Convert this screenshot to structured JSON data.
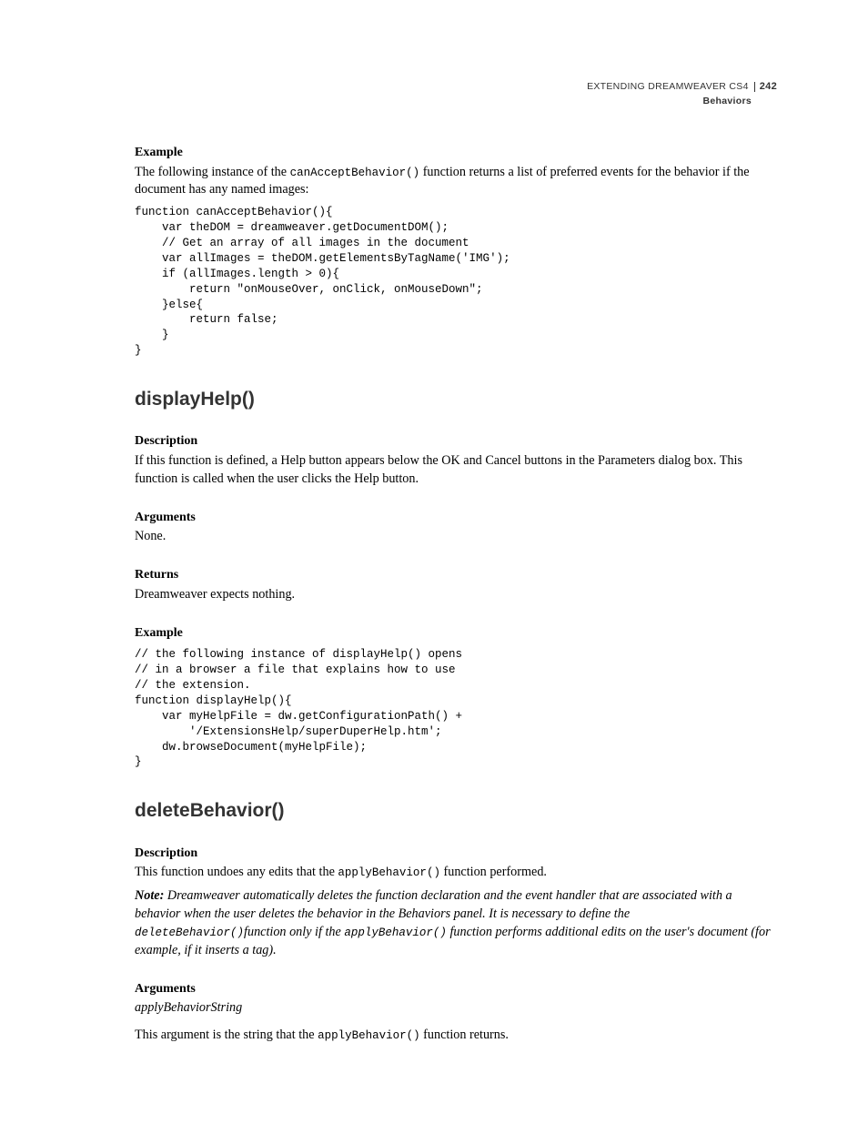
{
  "header": {
    "title": "EXTENDING DREAMWEAVER CS4",
    "section": "Behaviors",
    "page_number": "242"
  },
  "s1": {
    "example_h": "Example",
    "example_p_a": "The following instance of the ",
    "example_fn": "canAcceptBehavior()",
    "example_p_b": " function returns a list of preferred events for the behavior if the document has any named images:",
    "code": "function canAcceptBehavior(){\n    var theDOM = dreamweaver.getDocumentDOM();\n    // Get an array of all images in the document\n    var allImages = theDOM.getElementsByTagName('IMG');\n    if (allImages.length > 0){\n        return \"onMouseOver, onClick, onMouseDown\";\n    }else{\n        return false;\n    }\n}"
  },
  "s2": {
    "title": "displayHelp()",
    "desc_h": "Description",
    "desc_p": "If this function is defined, a Help button appears below the OK and Cancel buttons in the Parameters dialog box. This function is called when the user clicks the Help button.",
    "args_h": "Arguments",
    "args_p": "None.",
    "ret_h": "Returns",
    "ret_p": "Dreamweaver expects nothing.",
    "ex_h": "Example",
    "code": "// the following instance of displayHelp() opens\n// in a browser a file that explains how to use\n// the extension.\nfunction displayHelp(){\n    var myHelpFile = dw.getConfigurationPath() +\n        '/ExtensionsHelp/superDuperHelp.htm';\n    dw.browseDocument(myHelpFile);\n}"
  },
  "s3": {
    "title": "deleteBehavior()",
    "desc_h": "Description",
    "desc_p_a": "This function undoes any edits that the ",
    "desc_fn": "applyBehavior()",
    "desc_p_b": " function performed.",
    "note_label": "Note:",
    "note_a": " Dreamweaver automatically deletes the function declaration and the event handler that are associated with a behavior when the user deletes the behavior in the Behaviors panel. It is necessary to define the ",
    "note_fn1": "deleteBehavior()",
    "note_b": "function only if the ",
    "note_fn2": "applyBehavior()",
    "note_c": " function performs additional edits on the user's document (for example, if it inserts a tag).",
    "args_h": "Arguments",
    "args_param": "applyBehaviorString",
    "args_p_a": "This argument is the string that the ",
    "args_fn": "applyBehavior()",
    "args_p_b": " function returns."
  }
}
